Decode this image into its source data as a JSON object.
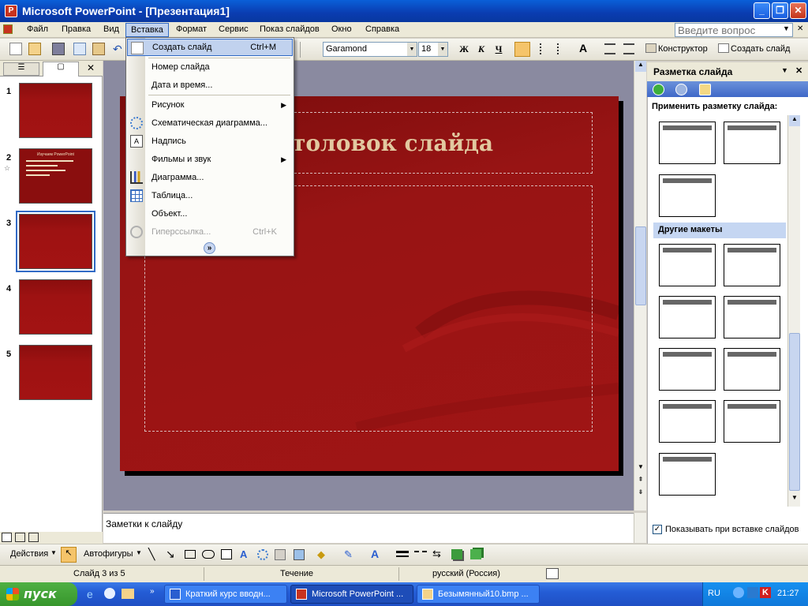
{
  "window": {
    "title": "Microsoft PowerPoint - [Презентация1]",
    "app_icon": "P"
  },
  "menubar": {
    "items": [
      "Файл",
      "Правка",
      "Вид",
      "Вставка",
      "Формат",
      "Сервис",
      "Показ слайдов",
      "Окно",
      "Справка"
    ],
    "active": "Вставка",
    "help_placeholder": "Введите вопрос"
  },
  "toolbar": {
    "font": "Garamond",
    "size": "18",
    "bold": "Ж",
    "italic": "К",
    "underline": "Ч",
    "designer": "Конструктор",
    "new_slide": "Создать слайд"
  },
  "insert_menu": {
    "items": [
      {
        "label": "Создать слайд",
        "shortcut": "Ctrl+M",
        "icon": "new-slide-icon"
      },
      {
        "label": "Номер слайда"
      },
      {
        "label": "Дата и время..."
      },
      {
        "label": "Рисунок",
        "submenu": true
      },
      {
        "label": "Схематическая диаграмма...",
        "icon": "diagram-icon"
      },
      {
        "label": "Надпись",
        "icon": "textbox-icon"
      },
      {
        "label": "Фильмы и звук",
        "submenu": true
      },
      {
        "label": "Диаграмма...",
        "icon": "chart-icon"
      },
      {
        "label": "Таблица...",
        "icon": "table-icon"
      },
      {
        "label": "Объект..."
      },
      {
        "label": "Гиперссылка...",
        "shortcut": "Ctrl+K",
        "disabled": true,
        "icon": "hyperlink-icon"
      }
    ],
    "expand": "»"
  },
  "slides_pane": {
    "thumbnails": [
      {
        "number": "1"
      },
      {
        "number": "2",
        "title": "Изучаем PowerPoint"
      },
      {
        "number": "3"
      },
      {
        "number": "4"
      },
      {
        "number": "5"
      }
    ],
    "selected": 3
  },
  "slide": {
    "title": "толовок слайда"
  },
  "notes": {
    "placeholder": "Заметки к слайду"
  },
  "task_pane": {
    "title": "Разметка слайда",
    "apply_label": "Применить разметку слайда:",
    "other_section": "Другие макеты",
    "show_on_insert": "Показывать при вставке слайдов"
  },
  "draw_toolbar": {
    "actions": "Действия",
    "autoshapes": "Автофигуры"
  },
  "status": {
    "slide": "Слайд 3 из 5",
    "design": "Течение",
    "language": "русский (Россия)"
  },
  "taskbar": {
    "start": "пуск",
    "tasks": [
      "Краткий курс вводн...",
      "Microsoft PowerPoint ...",
      "Безымянный10.bmp ..."
    ],
    "lang": "RU",
    "clock": "21:27"
  }
}
